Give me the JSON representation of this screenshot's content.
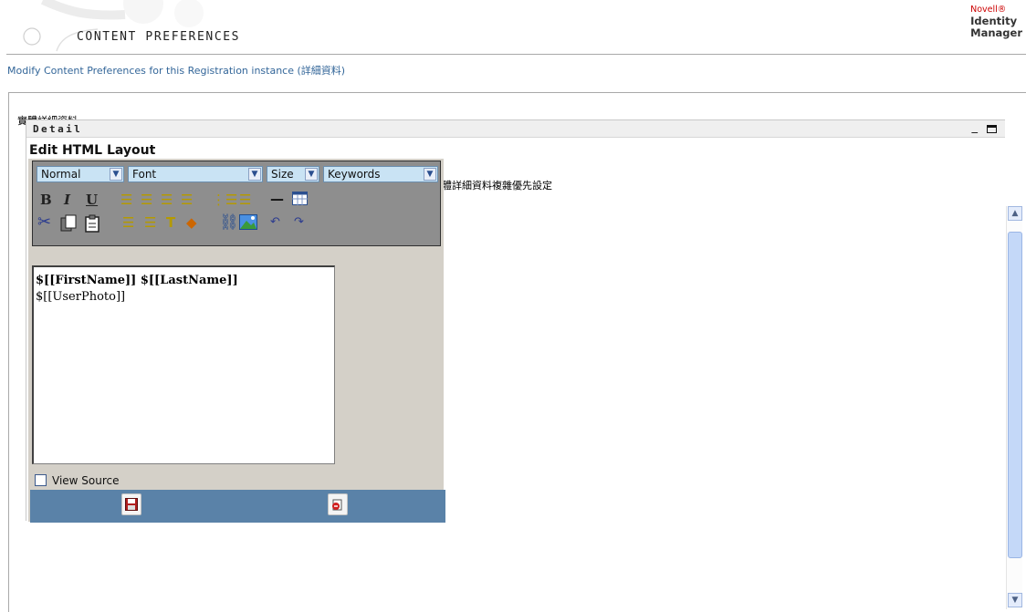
{
  "header": {
    "title": "CONTENT PREFERENCES",
    "brand_line1": "Novell®",
    "brand_line2": "Identity",
    "brand_line3": "Manager"
  },
  "subtitle": "Modify Content Preferences for this Registration instance (詳細資料)",
  "content": {
    "entity_label": "實體詳細資料",
    "preferences_heading": "實體詳細資料複雜優先設定"
  },
  "portlet": {
    "title": "Detail",
    "editor_title": "Edit HTML Layout",
    "toolbar": {
      "format_select": "Normal",
      "font_select": "Font",
      "size_select": "Size",
      "keywords_select": "Keywords"
    },
    "html_lines": [
      "$[[FirstName]] $[[LastName]]",
      "$[[UserPhoto]]"
    ],
    "view_source_label": "View Source",
    "view_source_checked": false
  },
  "colors": {
    "link_blue": "#336699",
    "bottom_bar": "#5a82a8",
    "select_bg": "#c9e3f4",
    "toolbar_bg": "#8e8e8e"
  }
}
